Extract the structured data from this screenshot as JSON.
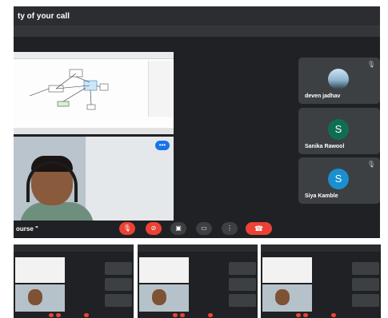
{
  "meeting": {
    "title_fragment": "ty of your call",
    "name_fragment": "ourse \""
  },
  "participants": [
    {
      "name": "deven jadhav",
      "initial": "",
      "avatar_type": "photo",
      "avatar_color": "#8fb4cf"
    },
    {
      "name": "Sanika Rawool",
      "initial": "S",
      "avatar_type": "letter",
      "avatar_color": "#0f6e52"
    },
    {
      "name": "Siya Kamble",
      "initial": "S",
      "avatar_type": "letter",
      "avatar_color": "#1a8fd1"
    }
  ],
  "controls": [
    {
      "id": "mic",
      "icon": "mic-off-icon",
      "color": "#ea4335"
    },
    {
      "id": "camera",
      "icon": "camera-off-icon",
      "color": "#ea4335"
    },
    {
      "id": "captions",
      "icon": "captions-icon",
      "color": "#3c4043"
    },
    {
      "id": "present",
      "icon": "present-screen-icon",
      "color": "#3c4043"
    },
    {
      "id": "more",
      "icon": "more-vert-icon",
      "color": "#3c4043"
    },
    {
      "id": "hangup",
      "icon": "phone-hangup-icon",
      "color": "#ea4335"
    }
  ],
  "icons": {
    "mic_off": "🎙",
    "camera_off": "⊘",
    "captions": "▣",
    "present": "▭",
    "more": "⋮",
    "hangup": "☎",
    "speaking": "•••"
  },
  "colors": {
    "background": "#202124",
    "tile": "#3c4043",
    "danger": "#ea4335",
    "accent": "#1a73e8"
  }
}
